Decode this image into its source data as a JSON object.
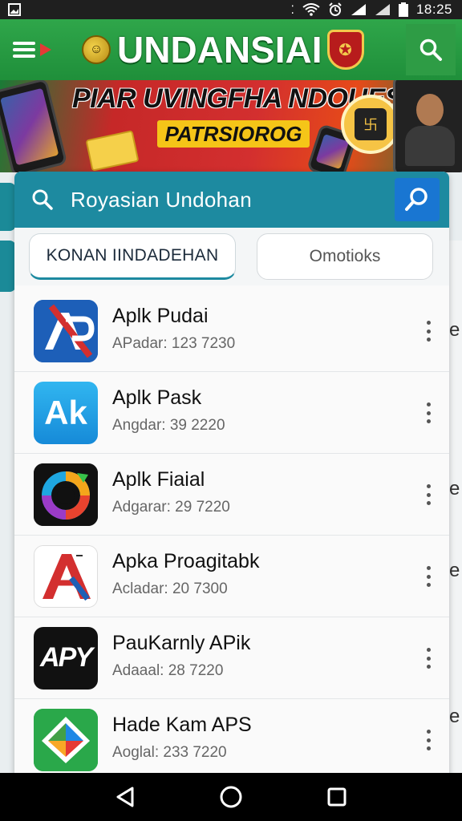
{
  "status_bar": {
    "time": "18:25",
    "icons": [
      "image-icon",
      "wifi-icon",
      "alarm-icon",
      "signal-icon",
      "signal-icon",
      "battery-icon"
    ]
  },
  "app_bar": {
    "title": "UNDANSIAI",
    "icons": [
      "menu-icon",
      "emblem-icon",
      "crest-icon",
      "search-icon"
    ]
  },
  "banner": {
    "headline": "PIAR UVINGFHA NDOUESIA",
    "subtitle": "PATRSIOROG",
    "coin_glyph": "卐"
  },
  "search": {
    "value": "Royasian Undohan"
  },
  "tabs": [
    {
      "label": "KONAN IINDADEHAN",
      "active": true
    },
    {
      "label": "Omotioks",
      "active": false
    }
  ],
  "apps": [
    {
      "name": "Aplk Pudai",
      "meta": "APadar: 123 7230",
      "icon": "ap-icon",
      "icon_text": "AP"
    },
    {
      "name": "Aplk Pask",
      "meta": "Angdar: 39 2220",
      "icon": "ak-icon",
      "icon_text": "Ak"
    },
    {
      "name": "Aplk Fiaial",
      "meta": "Adgarar: 29 7220",
      "icon": "ring-icon",
      "icon_text": ""
    },
    {
      "name": "Apka Proagitabk",
      "meta": "Acladar: 20 7300",
      "icon": "a-icon",
      "icon_text": "A"
    },
    {
      "name": "PauKarnly APik",
      "meta": "Adaaal: 28 7220",
      "icon": "apy-icon",
      "icon_text": "APY"
    },
    {
      "name": "Hade Kam APS",
      "meta": "Aoglal: 233 7220",
      "icon": "diamond-icon",
      "icon_text": ""
    }
  ],
  "colors": {
    "app_bar": "#2fa64a",
    "search_bar": "#1d8aa0",
    "search_button": "#1976d2",
    "tab_underline": "#1d8aa0"
  }
}
